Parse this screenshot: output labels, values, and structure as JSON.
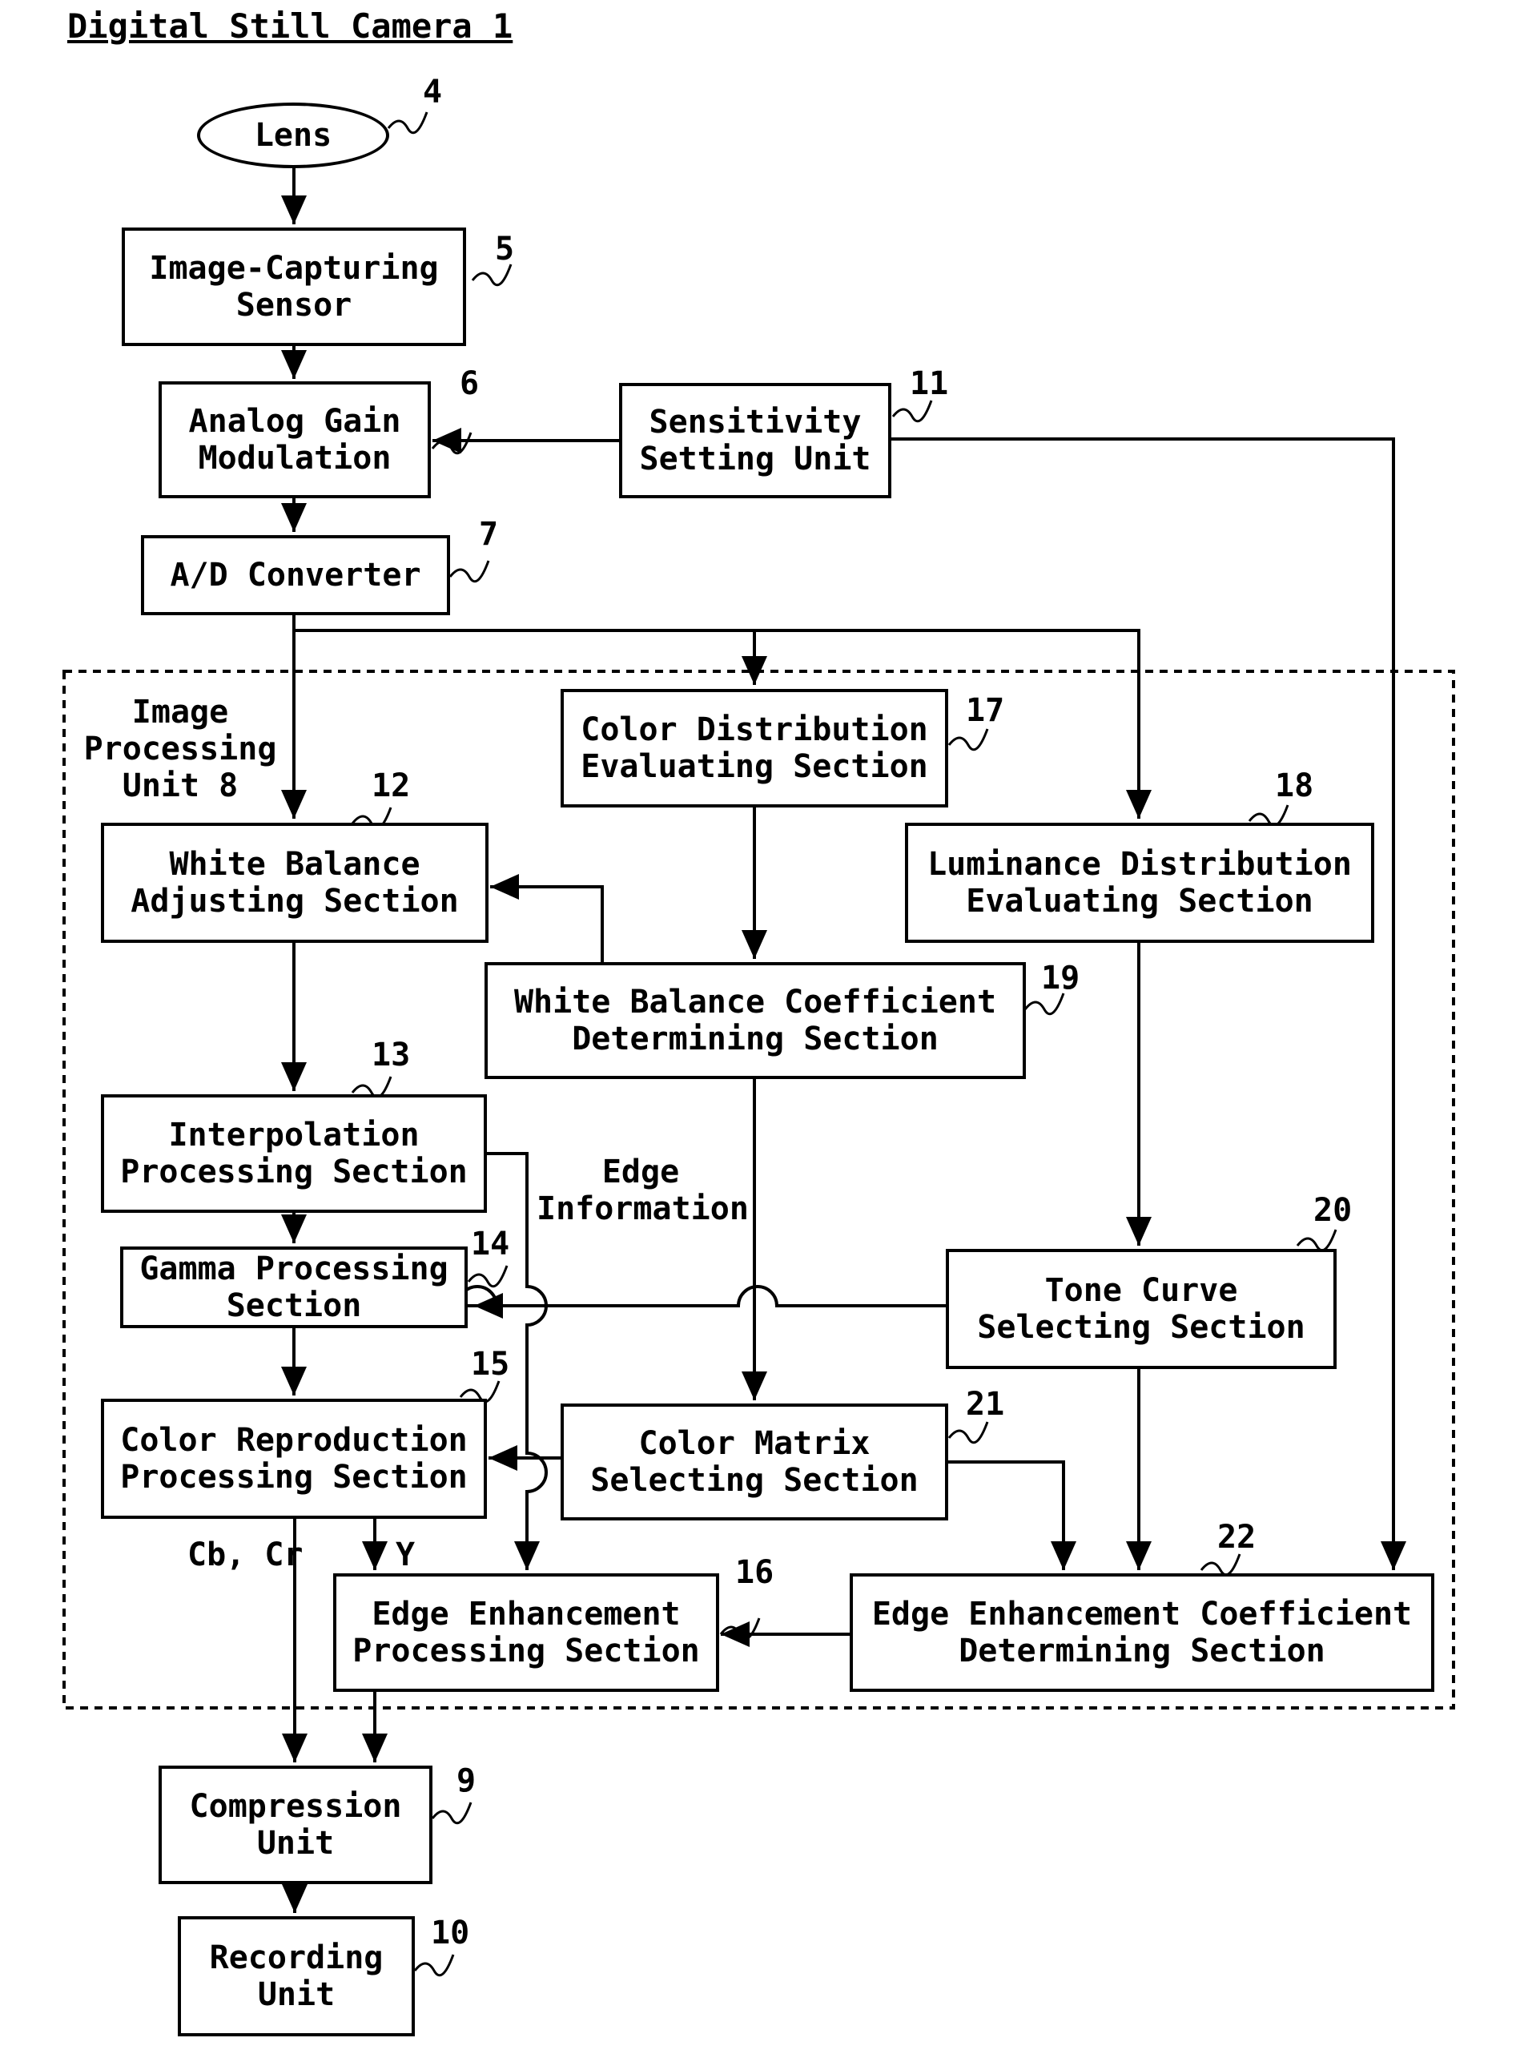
{
  "title": "Digital Still Camera 1",
  "container": {
    "label": "Image\nProcessing\nUnit 8"
  },
  "blocks": {
    "lens": {
      "label": "Lens",
      "ref": "4"
    },
    "sensor": {
      "label": "Image-Capturing\nSensor",
      "ref": "5"
    },
    "analog_gain": {
      "label": "Analog Gain\nModulation",
      "ref": "6"
    },
    "ad": {
      "label": "A/D Converter",
      "ref": "7"
    },
    "compression": {
      "label": "Compression\nUnit",
      "ref": "9"
    },
    "recording": {
      "label": "Recording\nUnit",
      "ref": "10"
    },
    "sensitivity": {
      "label": "Sensitivity\nSetting Unit",
      "ref": "11"
    },
    "wb_adjust": {
      "label": "White Balance\nAdjusting Section",
      "ref": "12"
    },
    "interp": {
      "label": "Interpolation\nProcessing Section",
      "ref": "13"
    },
    "gamma": {
      "label": "Gamma Processing\nSection",
      "ref": "14"
    },
    "color_repro": {
      "label": "Color Reproduction\nProcessing Section",
      "ref": "15"
    },
    "edge_proc": {
      "label": "Edge Enhancement\nProcessing Section",
      "ref": "16"
    },
    "color_dist": {
      "label": "Color Distribution\nEvaluating Section",
      "ref": "17"
    },
    "lum_dist": {
      "label": "Luminance Distribution\nEvaluating Section",
      "ref": "18"
    },
    "wb_coef": {
      "label": "White Balance Coefficient\nDetermining Section",
      "ref": "19"
    },
    "tone": {
      "label": "Tone Curve\nSelecting Section",
      "ref": "20"
    },
    "color_matrix": {
      "label": "Color Matrix\nSelecting Section",
      "ref": "21"
    },
    "edge_coef": {
      "label": "Edge Enhancement Coefficient\nDetermining Section",
      "ref": "22"
    }
  },
  "annotations": {
    "edge_info": "Edge\nInformation",
    "cbcr": "Cb, Cr",
    "y": "Y"
  }
}
